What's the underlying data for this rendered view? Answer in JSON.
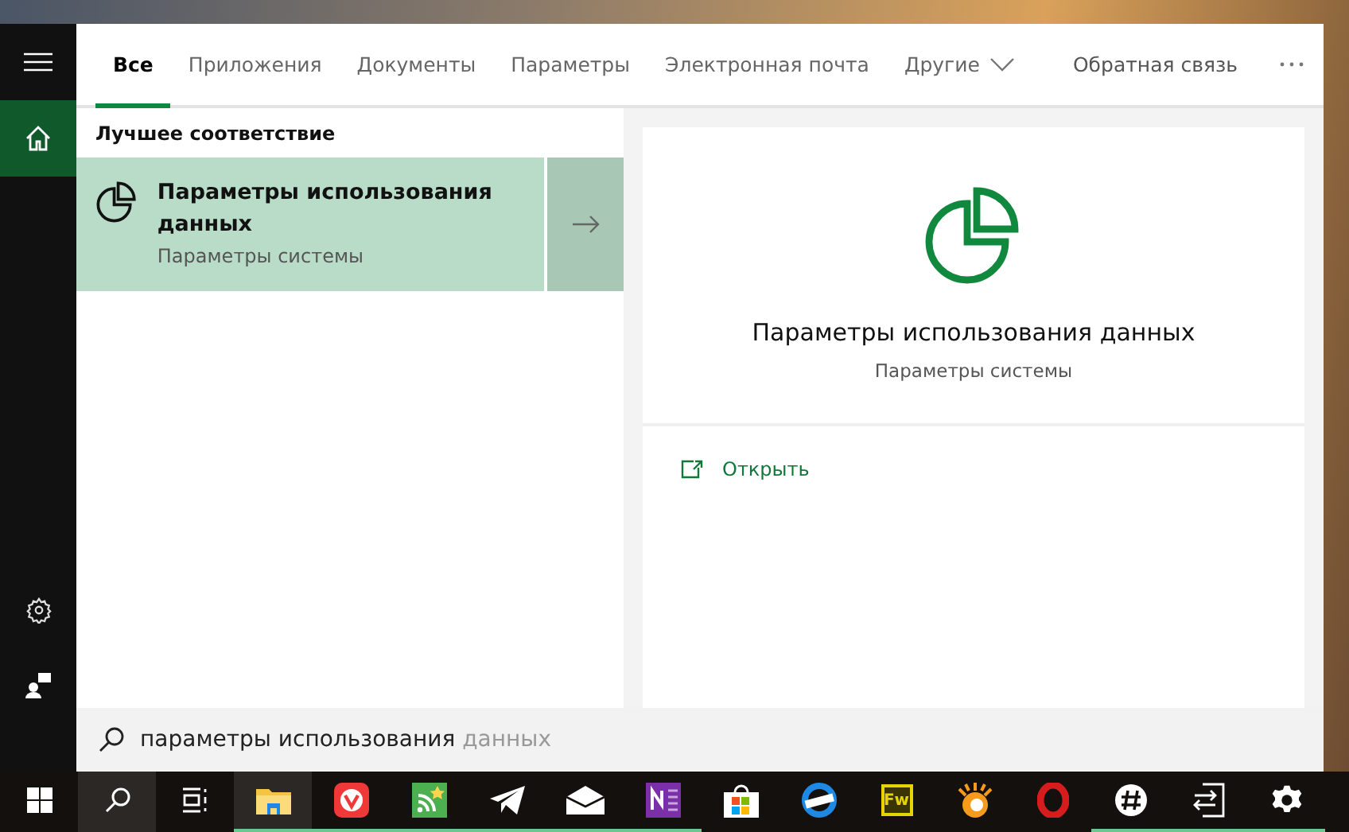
{
  "rail": [
    {
      "kind": "menu",
      "selected": false
    },
    {
      "kind": "home",
      "selected": true
    },
    {
      "kind": "settings",
      "selected": false
    },
    {
      "kind": "feedback",
      "selected": false
    }
  ],
  "tabs": [
    {
      "label": "Все",
      "selected": true
    },
    {
      "label": "Приложения",
      "selected": false
    },
    {
      "label": "Документы",
      "selected": false
    },
    {
      "label": "Параметры",
      "selected": false
    },
    {
      "label": "Электронная почта",
      "selected": false
    },
    {
      "label": "Другие",
      "selected": false,
      "kind": "dropdown"
    }
  ],
  "feedback": "Обратная связь",
  "best_match": {
    "heading": "Лучшее соответствие",
    "title": "Параметры использования данных",
    "subtitle": "Параметры системы",
    "selected": true
  },
  "preview": {
    "title": "Параметры использования данных",
    "subtitle": "Параметры системы",
    "actions": [
      {
        "label": "Открыть"
      }
    ]
  },
  "search": {
    "value": "параметры использования",
    "suggestion": "данных"
  },
  "taskbar": [
    {
      "kind": "start",
      "running": false,
      "selected": false
    },
    {
      "kind": "search",
      "running": false,
      "selected": true
    },
    {
      "kind": "taskview",
      "running": false,
      "selected": false
    },
    {
      "kind": "explorer",
      "running": true,
      "selected": true
    },
    {
      "kind": "vivaldi",
      "running": true,
      "selected": false
    },
    {
      "kind": "rss",
      "running": true,
      "selected": false
    },
    {
      "kind": "telegram",
      "running": true,
      "selected": false
    },
    {
      "kind": "mail",
      "running": true,
      "selected": false
    },
    {
      "kind": "onenote",
      "running": true,
      "selected": false
    },
    {
      "kind": "store",
      "running": false,
      "selected": false
    },
    {
      "kind": "edge",
      "running": false,
      "selected": false
    },
    {
      "kind": "fireworks",
      "label": "Fw",
      "running": false,
      "selected": false
    },
    {
      "kind": "viewer",
      "running": false,
      "selected": false
    },
    {
      "kind": "opera",
      "running": false,
      "selected": false
    },
    {
      "kind": "slack",
      "running": true,
      "selected": false
    },
    {
      "kind": "exit",
      "running": true,
      "selected": false
    },
    {
      "kind": "gear",
      "running": true,
      "selected": false
    }
  ]
}
